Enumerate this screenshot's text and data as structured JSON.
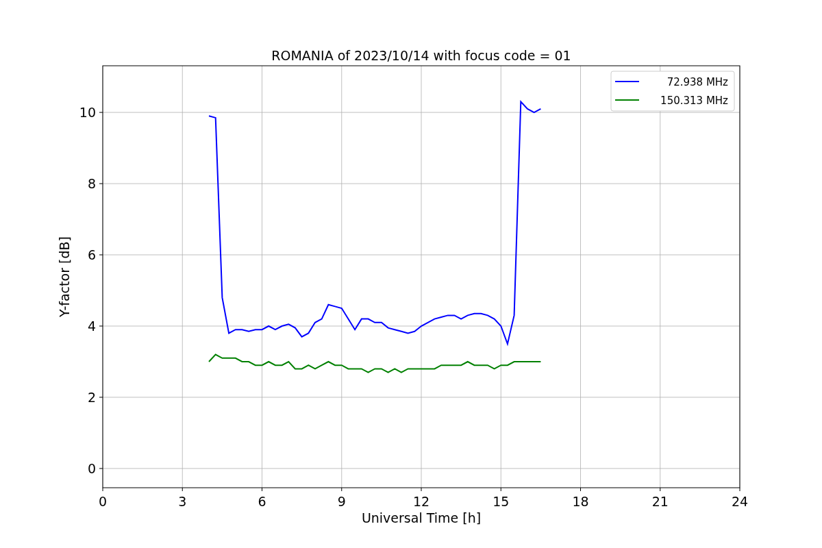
{
  "figure": {
    "chart_data": {
      "type": "line",
      "title": "ROMANIA of 2023/10/14 with focus code = 01",
      "xlabel": "Universal Time [h]",
      "ylabel": "Y-factor [dB]",
      "x": [
        4,
        4.25,
        4.5,
        4.75,
        5,
        5.25,
        5.5,
        5.75,
        6,
        6.25,
        6.5,
        6.75,
        7,
        7.25,
        7.5,
        7.75,
        8,
        8.25,
        8.5,
        8.75,
        9,
        9.25,
        9.5,
        9.75,
        10,
        10.25,
        10.5,
        10.75,
        11,
        11.25,
        11.5,
        11.75,
        12,
        12.25,
        12.5,
        12.75,
        13,
        13.25,
        13.5,
        13.75,
        14,
        14.25,
        14.5,
        14.75,
        15,
        15.25,
        15.5,
        15.75,
        16,
        16.25,
        16.5
      ],
      "series": [
        {
          "name": "72.938 MHz",
          "color": "#0000ff",
          "values": [
            9.9,
            9.85,
            4.8,
            3.8,
            3.9,
            3.9,
            3.85,
            3.9,
            3.9,
            4.0,
            3.9,
            4.0,
            4.05,
            3.95,
            3.7,
            3.8,
            4.1,
            4.2,
            4.6,
            4.55,
            4.5,
            4.2,
            3.9,
            4.2,
            4.2,
            4.1,
            4.1,
            3.95,
            3.9,
            3.85,
            3.8,
            3.85,
            4.0,
            4.1,
            4.2,
            4.25,
            4.3,
            4.3,
            4.2,
            4.3,
            4.35,
            4.35,
            4.3,
            4.2,
            4.0,
            3.5,
            4.3,
            10.3,
            10.1,
            10.0,
            10.1
          ]
        },
        {
          "name": "150.313 MHz",
          "color": "#008000",
          "values": [
            3.0,
            3.2,
            3.1,
            3.1,
            3.1,
            3.0,
            3.0,
            2.9,
            2.9,
            3.0,
            2.9,
            2.9,
            3.0,
            2.8,
            2.8,
            2.9,
            2.8,
            2.9,
            3.0,
            2.9,
            2.9,
            2.8,
            2.8,
            2.8,
            2.7,
            2.8,
            2.8,
            2.7,
            2.8,
            2.7,
            2.8,
            2.8,
            2.8,
            2.8,
            2.8,
            2.9,
            2.9,
            2.9,
            2.9,
            3.0,
            2.9,
            2.9,
            2.9,
            2.8,
            2.9,
            2.9,
            3.0,
            3.0,
            3.0,
            3.0,
            3.0
          ]
        }
      ],
      "xlim": [
        0,
        24
      ],
      "ylim": [
        -0.54,
        11.31
      ],
      "xticks": [
        0,
        3,
        6,
        9,
        12,
        15,
        18,
        21,
        24
      ],
      "yticks": [
        0,
        2,
        4,
        6,
        8,
        10
      ],
      "grid": true
    }
  }
}
